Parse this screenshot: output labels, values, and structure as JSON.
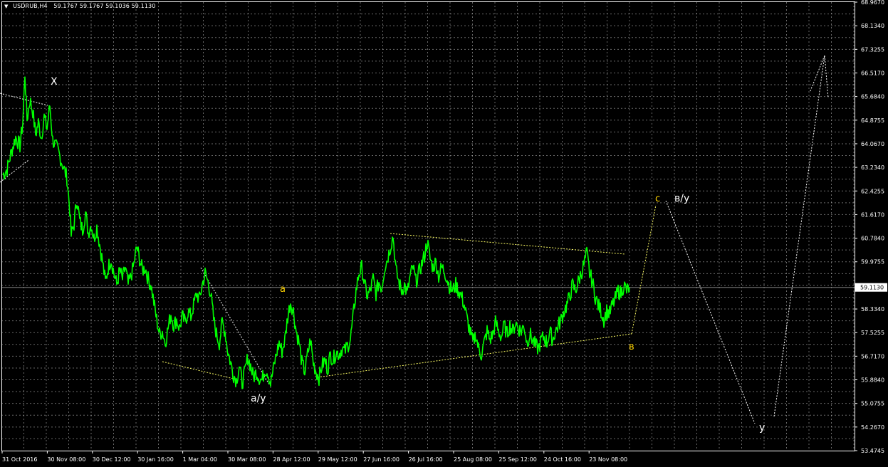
{
  "header": {
    "dropdown_icon": "triangle-down-icon",
    "symbol": "USDRUB,H4",
    "ohlc": "59.1767 59.1767 59.1036 59.1130"
  },
  "colors": {
    "background": "#000000",
    "grid": "#c0c0c0",
    "price_line": "#00ff00",
    "axis": "#ffffff",
    "label_white": "#ffffff",
    "label_yellow": "#ffd400",
    "channel_yellow": "#ffff66"
  },
  "chart_data": {
    "type": "line",
    "title": "USDRUB,H4",
    "current_price": "59.1130",
    "ylim": [
      53.4745,
      68.967
    ],
    "y_ticks": [
      "68.9670",
      "68.1340",
      "67.3255",
      "66.5170",
      "65.6840",
      "64.8755",
      "64.0670",
      "63.2340",
      "62.4255",
      "61.6170",
      "60.7840",
      "59.9755",
      "59.1130",
      "58.3340",
      "57.5255",
      "56.7170",
      "55.8840",
      "55.0755",
      "54.2670",
      "53.4745"
    ],
    "x_ticks": [
      "31 Oct 2016",
      "30 Nov 08:00",
      "30 Dec 12:00",
      "30 Jan 16:00",
      "1 Mar 04:00",
      "30 Mar 08:00",
      "28 Apr 12:00",
      "29 May 12:00",
      "27 Jun 16:00",
      "26 Jul 16:00",
      "25 Aug 08:00",
      "25 Sep 12:00",
      "24 Oct 16:00",
      "23 Nov 08:00"
    ],
    "grid": true,
    "series": [
      {
        "values": [
          [
            0,
            63.0
          ],
          [
            6,
            63.2
          ],
          [
            12,
            63.8
          ],
          [
            18,
            64.3
          ],
          [
            24,
            64.0
          ],
          [
            28,
            64.8
          ],
          [
            31,
            66.5
          ],
          [
            34,
            64.9
          ],
          [
            38,
            65.6
          ],
          [
            42,
            65.2
          ],
          [
            46,
            64.4
          ],
          [
            50,
            64.8
          ],
          [
            54,
            64.3
          ],
          [
            58,
            65.0
          ],
          [
            62,
            64.6
          ],
          [
            66,
            65.4
          ],
          [
            70,
            64.2
          ],
          [
            74,
            64.0
          ],
          [
            78,
            63.8
          ],
          [
            82,
            63.5
          ],
          [
            86,
            63.2
          ],
          [
            90,
            62.9
          ],
          [
            94,
            61.8
          ],
          [
            96,
            60.9
          ],
          [
            100,
            61.3
          ],
          [
            104,
            62.2
          ],
          [
            108,
            61.4
          ],
          [
            112,
            61.1
          ],
          [
            116,
            61.7
          ],
          [
            120,
            61.0
          ],
          [
            124,
            61.3
          ],
          [
            128,
            60.8
          ],
          [
            132,
            61.2
          ],
          [
            136,
            60.6
          ],
          [
            140,
            60.0
          ],
          [
            144,
            59.3
          ],
          [
            148,
            59.8
          ],
          [
            152,
            60.1
          ],
          [
            156,
            59.6
          ],
          [
            160,
            59.2
          ],
          [
            164,
            59.7
          ],
          [
            168,
            59.4
          ],
          [
            172,
            59.8
          ],
          [
            176,
            59.2
          ],
          [
            180,
            59.5
          ],
          [
            184,
            59.9
          ],
          [
            188,
            60.5
          ],
          [
            192,
            60.1
          ],
          [
            196,
            59.7
          ],
          [
            200,
            59.8
          ],
          [
            204,
            59.4
          ],
          [
            208,
            59.2
          ],
          [
            212,
            58.6
          ],
          [
            216,
            58.0
          ],
          [
            220,
            57.5
          ],
          [
            224,
            57.6
          ],
          [
            228,
            57.2
          ],
          [
            232,
            57.7
          ],
          [
            236,
            58.2
          ],
          [
            240,
            57.8
          ],
          [
            244,
            58.0
          ],
          [
            248,
            57.7
          ],
          [
            252,
            58.1
          ],
          [
            256,
            57.9
          ],
          [
            260,
            58.3
          ],
          [
            264,
            58.1
          ],
          [
            268,
            58.5
          ],
          [
            272,
            58.9
          ],
          [
            276,
            58.7
          ],
          [
            280,
            59.2
          ],
          [
            284,
            59.6
          ],
          [
            288,
            59.3
          ],
          [
            292,
            58.9
          ],
          [
            296,
            58.0
          ],
          [
            300,
            57.5
          ],
          [
            304,
            57.2
          ],
          [
            308,
            57.9
          ],
          [
            312,
            57.6
          ],
          [
            316,
            56.9
          ],
          [
            320,
            56.5
          ],
          [
            324,
            56.1
          ],
          [
            328,
            55.9
          ],
          [
            332,
            56.4
          ],
          [
            336,
            55.8
          ],
          [
            340,
            56.2
          ],
          [
            344,
            56.7
          ],
          [
            348,
            56.4
          ],
          [
            352,
            56.0
          ],
          [
            356,
            56.2
          ],
          [
            360,
            56.0
          ],
          [
            364,
            55.9
          ],
          [
            368,
            56.3
          ],
          [
            372,
            56.2
          ],
          [
            376,
            55.8
          ],
          [
            380,
            56.3
          ],
          [
            384,
            56.8
          ],
          [
            388,
            57.2
          ],
          [
            392,
            56.9
          ],
          [
            396,
            57.3
          ],
          [
            400,
            58.1
          ],
          [
            404,
            58.6
          ],
          [
            408,
            58.3
          ],
          [
            412,
            57.6
          ],
          [
            416,
            57.2
          ],
          [
            420,
            56.5
          ],
          [
            424,
            56.2
          ],
          [
            428,
            56.8
          ],
          [
            432,
            57.3
          ],
          [
            436,
            56.5
          ],
          [
            440,
            56.2
          ],
          [
            444,
            56.0
          ],
          [
            448,
            56.4
          ],
          [
            452,
            56.6
          ],
          [
            456,
            56.3
          ],
          [
            460,
            56.8
          ],
          [
            464,
            56.6
          ],
          [
            468,
            56.9
          ],
          [
            472,
            56.8
          ],
          [
            476,
            57.0
          ],
          [
            480,
            56.9
          ],
          [
            484,
            57.1
          ],
          [
            488,
            57.3
          ],
          [
            492,
            58.1
          ],
          [
            496,
            59.0
          ],
          [
            500,
            59.6
          ],
          [
            504,
            59.8
          ],
          [
            508,
            59.2
          ],
          [
            512,
            58.8
          ],
          [
            516,
            59.0
          ],
          [
            520,
            59.4
          ],
          [
            524,
            58.9
          ],
          [
            528,
            59.3
          ],
          [
            532,
            59.1
          ],
          [
            536,
            59.8
          ],
          [
            540,
            60.1
          ],
          [
            544,
            60.5
          ],
          [
            548,
            60.9
          ],
          [
            552,
            59.7
          ],
          [
            556,
            59.3
          ],
          [
            560,
            59.0
          ],
          [
            564,
            59.2
          ],
          [
            568,
            58.9
          ],
          [
            572,
            59.5
          ],
          [
            576,
            59.8
          ],
          [
            580,
            59.3
          ],
          [
            584,
            59.6
          ],
          [
            588,
            59.9
          ],
          [
            592,
            60.2
          ],
          [
            596,
            60.7
          ],
          [
            600,
            60.1
          ],
          [
            604,
            59.8
          ],
          [
            608,
            60.0
          ],
          [
            612,
            59.5
          ],
          [
            616,
            59.8
          ],
          [
            620,
            59.7
          ],
          [
            624,
            59.4
          ],
          [
            628,
            59.1
          ],
          [
            632,
            59.0
          ],
          [
            636,
            59.2
          ],
          [
            640,
            59.0
          ],
          [
            644,
            58.8
          ],
          [
            648,
            58.5
          ],
          [
            652,
            58.0
          ],
          [
            656,
            57.6
          ],
          [
            660,
            57.2
          ],
          [
            664,
            57.5
          ],
          [
            668,
            57.0
          ],
          [
            672,
            56.8
          ],
          [
            676,
            57.2
          ],
          [
            680,
            57.6
          ],
          [
            684,
            57.3
          ],
          [
            688,
            57.5
          ],
          [
            692,
            57.9
          ],
          [
            696,
            57.6
          ],
          [
            700,
            57.4
          ],
          [
            704,
            57.8
          ],
          [
            708,
            57.5
          ],
          [
            712,
            57.8
          ],
          [
            716,
            57.6
          ],
          [
            720,
            57.9
          ],
          [
            724,
            57.7
          ],
          [
            728,
            57.6
          ],
          [
            732,
            57.8
          ],
          [
            736,
            57.2
          ],
          [
            740,
            57.5
          ],
          [
            744,
            57.3
          ],
          [
            748,
            57.1
          ],
          [
            752,
            57.0
          ],
          [
            756,
            57.3
          ],
          [
            760,
            57.4
          ],
          [
            764,
            57.2
          ],
          [
            768,
            57.6
          ],
          [
            772,
            57.3
          ],
          [
            776,
            57.6
          ],
          [
            780,
            57.8
          ],
          [
            784,
            58.0
          ],
          [
            788,
            58.3
          ],
          [
            792,
            58.5
          ],
          [
            796,
            58.8
          ],
          [
            800,
            59.2
          ],
          [
            804,
            59.0
          ],
          [
            808,
            59.3
          ],
          [
            812,
            59.6
          ],
          [
            816,
            59.9
          ],
          [
            820,
            60.3
          ],
          [
            824,
            59.6
          ],
          [
            828,
            59.3
          ],
          [
            832,
            58.8
          ],
          [
            836,
            58.5
          ],
          [
            840,
            58.3
          ],
          [
            844,
            58.0
          ],
          [
            848,
            58.3
          ],
          [
            852,
            58.2
          ],
          [
            856,
            58.5
          ],
          [
            860,
            58.7
          ],
          [
            864,
            59.0
          ],
          [
            868,
            58.9
          ],
          [
            872,
            59.2
          ],
          [
            876,
            59.0
          ],
          [
            880,
            59.1
          ]
        ]
      }
    ],
    "annotations": [
      {
        "text": "X",
        "color": "white"
      },
      {
        "text": "a/y",
        "color": "white"
      },
      {
        "text": "a",
        "color": "yellow"
      },
      {
        "text": "c",
        "color": "yellow"
      },
      {
        "text": "в/y",
        "color": "white"
      },
      {
        "text": "в",
        "color": "yellow"
      },
      {
        "text": "y",
        "color": "white"
      }
    ]
  }
}
